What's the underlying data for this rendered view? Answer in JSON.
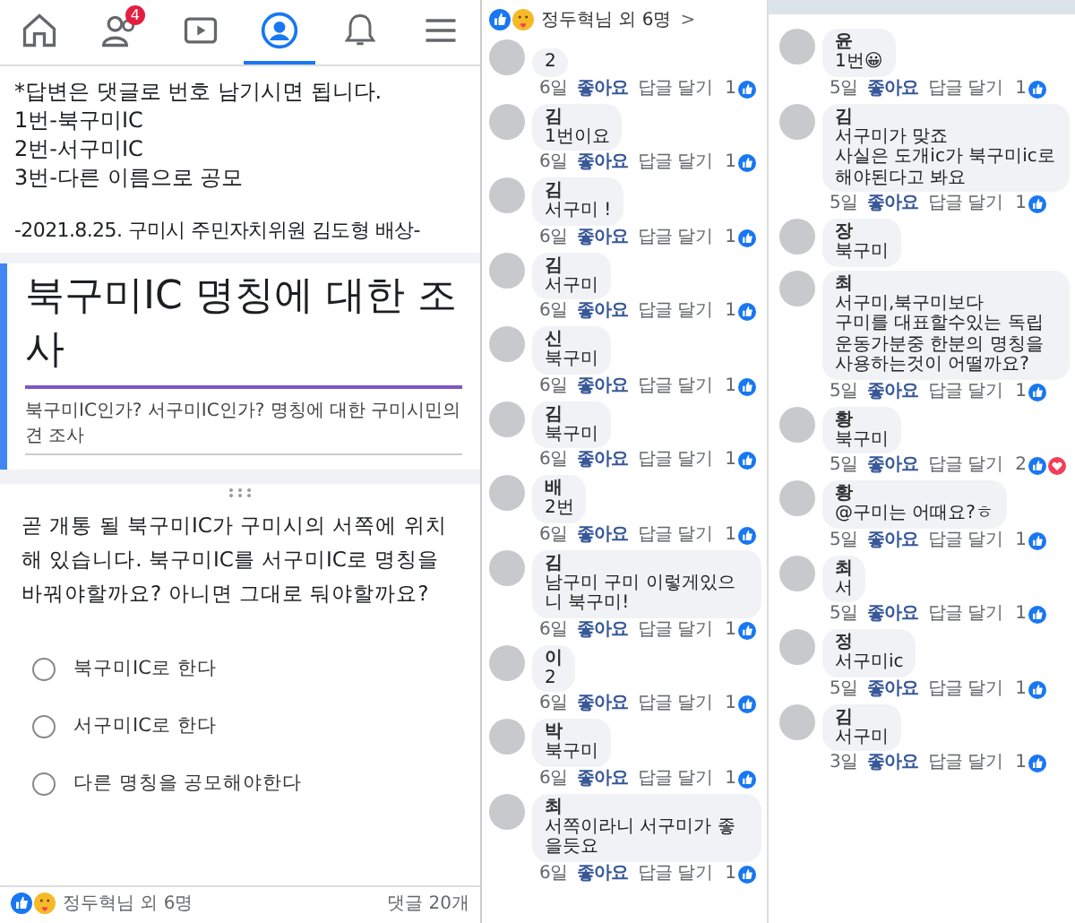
{
  "nav": {
    "tabs": [
      {
        "kind": "home",
        "selected": false
      },
      {
        "kind": "friends",
        "selected": false,
        "badge": "4"
      },
      {
        "kind": "video",
        "selected": false
      },
      {
        "kind": "profile",
        "selected": true
      },
      {
        "kind": "bell",
        "selected": false
      },
      {
        "kind": "menu",
        "selected": false
      }
    ]
  },
  "post": {
    "lines": [
      "*답변은 댓글로 번호 남기시면 됩니다.",
      "1번-북구미IC",
      "2번-서구미IC",
      "3번-다른 이름으로 공모"
    ],
    "signature": "-2021.8.25. 구미시 주민자치위원 김도형 배상-"
  },
  "form": {
    "title": "북구미IC 명칭에 대한 조사",
    "description": "북구미IC인가? 서구미IC인가? 명칭에 대한 구미시민의견 조사",
    "question": "곧 개통 될 북구미IC가 구미시의 서쪽에 위치해 있습니다. 북구미IC를 서구미IC로 명칭을 바꿔야할까요? 아니면 그대로 둬야할까요?",
    "options": [
      {
        "label": "북구미IC로 한다",
        "selected": false
      },
      {
        "label": "서구미IC로 한다",
        "selected": false
      },
      {
        "label": "다른 명칭을 공모해야한다",
        "selected": false
      }
    ]
  },
  "post_footer": {
    "reactions": [
      {
        "kind": "like"
      },
      {
        "kind": "care"
      }
    ],
    "reactors": "정두혁님 외 6명",
    "comments": "댓글 20개"
  },
  "comments_left": {
    "header": {
      "reactions": [
        {
          "kind": "like"
        },
        {
          "kind": "care"
        }
      ],
      "text": "정두혁님 외 6명",
      "chevron": ">"
    },
    "comments": [
      {
        "text": "2",
        "age": "6일",
        "like": "좋아요",
        "reply": "답글 달기",
        "count": "1",
        "reactions": [
          {
            "kind": "like"
          }
        ]
      },
      {
        "name": "김",
        "text": "1번이요",
        "age": "6일",
        "like": "좋아요",
        "reply": "답글 달기",
        "count": "1",
        "reactions": [
          {
            "kind": "like"
          }
        ]
      },
      {
        "name": "김",
        "text": "서구미 !",
        "age": "6일",
        "like": "좋아요",
        "reply": "답글 달기",
        "count": "1",
        "reactions": [
          {
            "kind": "like"
          }
        ]
      },
      {
        "name": "김",
        "text": "서구미",
        "age": "6일",
        "like": "좋아요",
        "reply": "답글 달기",
        "count": "1",
        "reactions": [
          {
            "kind": "like"
          }
        ]
      },
      {
        "name": "신",
        "text": "북구미",
        "age": "6일",
        "like": "좋아요",
        "reply": "답글 달기",
        "count": "1",
        "reactions": [
          {
            "kind": "like"
          }
        ]
      },
      {
        "name": "김",
        "text": "북구미",
        "age": "6일",
        "like": "좋아요",
        "reply": "답글 달기",
        "count": "1",
        "reactions": [
          {
            "kind": "like"
          }
        ]
      },
      {
        "name": "배",
        "text": "2번",
        "age": "6일",
        "like": "좋아요",
        "reply": "답글 달기",
        "count": "1",
        "reactions": [
          {
            "kind": "like"
          }
        ]
      },
      {
        "name": "김",
        "text": "남구미 구미 이렇게있으니 북구미!",
        "age": "6일",
        "like": "좋아요",
        "reply": "답글 달기",
        "count": "1",
        "reactions": [
          {
            "kind": "like"
          }
        ]
      },
      {
        "name": "이",
        "text": "2",
        "age": "6일",
        "like": "좋아요",
        "reply": "답글 달기",
        "count": "1",
        "reactions": [
          {
            "kind": "like"
          }
        ]
      },
      {
        "name": "박",
        "text": "북구미",
        "age": "6일",
        "like": "좋아요",
        "reply": "답글 달기",
        "count": "1",
        "reactions": [
          {
            "kind": "like"
          }
        ]
      },
      {
        "name": "최",
        "text": "서쪽이라니 서구미가 좋을듯요",
        "age": "6일",
        "like": "좋아요",
        "reply": "답글 달기",
        "count": "1",
        "reactions": [
          {
            "kind": "like"
          }
        ]
      }
    ]
  },
  "comments_right": {
    "comments": [
      {
        "name": "윤",
        "text": "1번😀",
        "age": "5일",
        "like": "좋아요",
        "reply": "답글 달기",
        "count": "1",
        "reactions": [
          {
            "kind": "like"
          }
        ]
      },
      {
        "name": "김",
        "text": "서구미가 맞죠\n사실은 도개ic가 북구미ic로 해야된다고 봐요",
        "age": "5일",
        "like": "좋아요",
        "reply": "답글 달기",
        "count": "1",
        "reactions": [
          {
            "kind": "like"
          }
        ]
      },
      {
        "name": "장",
        "text": "북구미"
      },
      {
        "name": "최",
        "text": "서구미,북구미보다\n구미를 대표할수있는 독립운동가분중 한분의 명칭을 사용하는것이 어떨까요?",
        "age": "5일",
        "like": "좋아요",
        "reply": "답글 달기",
        "count": "1",
        "reactions": [
          {
            "kind": "like"
          }
        ]
      },
      {
        "name": "황",
        "text": "북구미",
        "age": "5일",
        "like": "좋아요",
        "reply": "답글 달기",
        "count": "2",
        "reactions": [
          {
            "kind": "like"
          },
          {
            "kind": "love"
          }
        ]
      },
      {
        "name": "황",
        "text": "@구미는 어때요?ㅎ",
        "age": "5일",
        "like": "좋아요",
        "reply": "답글 달기",
        "count": "1",
        "reactions": [
          {
            "kind": "like"
          }
        ]
      },
      {
        "name": "최",
        "text": "서",
        "age": "5일",
        "like": "좋아요",
        "reply": "답글 달기",
        "count": "1",
        "reactions": [
          {
            "kind": "like"
          }
        ]
      },
      {
        "name": "정",
        "text": "서구미ic",
        "age": "5일",
        "like": "좋아요",
        "reply": "답글 달기",
        "count": "1",
        "reactions": [
          {
            "kind": "like"
          }
        ]
      },
      {
        "name": "김",
        "text": "서구미",
        "age": "3일",
        "like": "좋아요",
        "reply": "답글 달기",
        "count": "1",
        "reactions": [
          {
            "kind": "like"
          }
        ]
      }
    ]
  }
}
